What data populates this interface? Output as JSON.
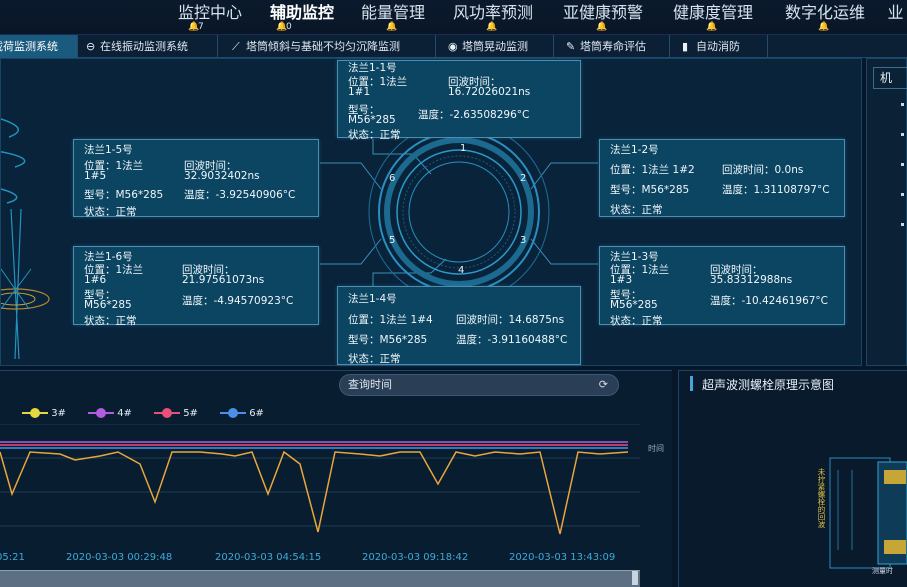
{
  "nav": {
    "items": [
      {
        "label": "监控中心",
        "count": "7"
      },
      {
        "label": "辅助监控",
        "count": "0"
      },
      {
        "label": "能量管理",
        "count": ""
      },
      {
        "label": "风功率预测",
        "count": ""
      },
      {
        "label": "亚健康预警",
        "count": ""
      },
      {
        "label": "健康度管理",
        "count": ""
      },
      {
        "label": "数字化运维",
        "count": ""
      },
      {
        "label": "业",
        "count": ""
      }
    ],
    "active_index": 1
  },
  "subtabs": [
    {
      "label": "载荷监测系统",
      "icon": ""
    },
    {
      "label": "在线振动监测系统",
      "icon": "gauge-icon"
    },
    {
      "label": "塔筒倾斜与基础不均匀沉降监测",
      "icon": "tilt-icon"
    },
    {
      "label": "塔筒晃动监测",
      "icon": "sway-icon"
    },
    {
      "label": "塔筒寿命评估",
      "icon": "pen-icon"
    },
    {
      "label": "自动消防",
      "icon": "extinguisher-icon"
    }
  ],
  "right_panel": {
    "title": "机"
  },
  "ring": {
    "labels": [
      "1",
      "2",
      "3",
      "4",
      "5",
      "6"
    ]
  },
  "flanges": [
    {
      "id": "f1",
      "title": "法兰1-1号",
      "pos_label": "位置：1法兰",
      "pos_value": "1#1",
      "time_label": "回波时间：",
      "time_value": "16.72026021ns",
      "model": "型号：",
      "model_value": "M56*285",
      "temp": "温度：-2.63508296°C",
      "status": "状态：正常"
    },
    {
      "id": "f2",
      "title": "法兰1-2号",
      "pos_label": "位置：1法兰 1#2",
      "time_label": "回波时间：0.0ns",
      "model": "型号：M56*285",
      "temp": "温度：1.31108797°C",
      "status": "状态：正常"
    },
    {
      "id": "f3",
      "title": "法兰1-3号",
      "pos_label": "位置：1法兰",
      "pos_value": "1#3",
      "time_label": "回波时间：",
      "time_value": "35.83312988ns",
      "model": "型号：",
      "model_value": "M56*285",
      "temp": "温度：-10.42461967°C",
      "status": "状态：正常"
    },
    {
      "id": "f4",
      "title": "法兰1-4号",
      "pos_label": "位置：1法兰 1#4",
      "time_label": "回波时间：14.6875ns",
      "model": "型号：M56*285",
      "temp": "温度：-3.91160488°C",
      "status": "状态：正常"
    },
    {
      "id": "f5",
      "title": "法兰1-5号",
      "pos_label": "位置：1法兰",
      "pos_value": "1#5",
      "time_label": "回波时间：",
      "time_value": "32.9032402ns",
      "model": "型号：M56*285",
      "temp": "温度：-3.92540906°C",
      "status": "状态：正常"
    },
    {
      "id": "f6",
      "title": "法兰1-6号",
      "pos_label": "位置：1法兰",
      "pos_value": "1#6",
      "time_label": "回波时间：",
      "time_value": "21.97561073ns",
      "model": "型号：",
      "model_value": "M56*285",
      "temp": "温度：-4.94570923°C",
      "status": "状态：正常"
    }
  ],
  "query": {
    "label": "查询时间"
  },
  "legend": [
    {
      "label": "3#",
      "color": "#e8d840"
    },
    {
      "label": "4#",
      "color": "#b25ce0"
    },
    {
      "label": "5#",
      "color": "#e8507a"
    },
    {
      "label": "6#",
      "color": "#4a90e8"
    }
  ],
  "chart_data": {
    "type": "line",
    "x_ticks": [
      "05:21",
      "2020-03-03 00:29:48",
      "2020-03-03 04:54:15",
      "2020-03-03 09:18:42",
      "2020-03-03 13:43:09"
    ],
    "axis_end_label": "时间",
    "series_colors": [
      "#e8a63c",
      "#b25ce0",
      "#e8507a",
      "#4a90e8"
    ]
  },
  "ultrasonic": {
    "title": "超声波测螺栓原理示意图",
    "side_label": "未拧紧螺栓的回波",
    "bottom_label": "测量时"
  }
}
